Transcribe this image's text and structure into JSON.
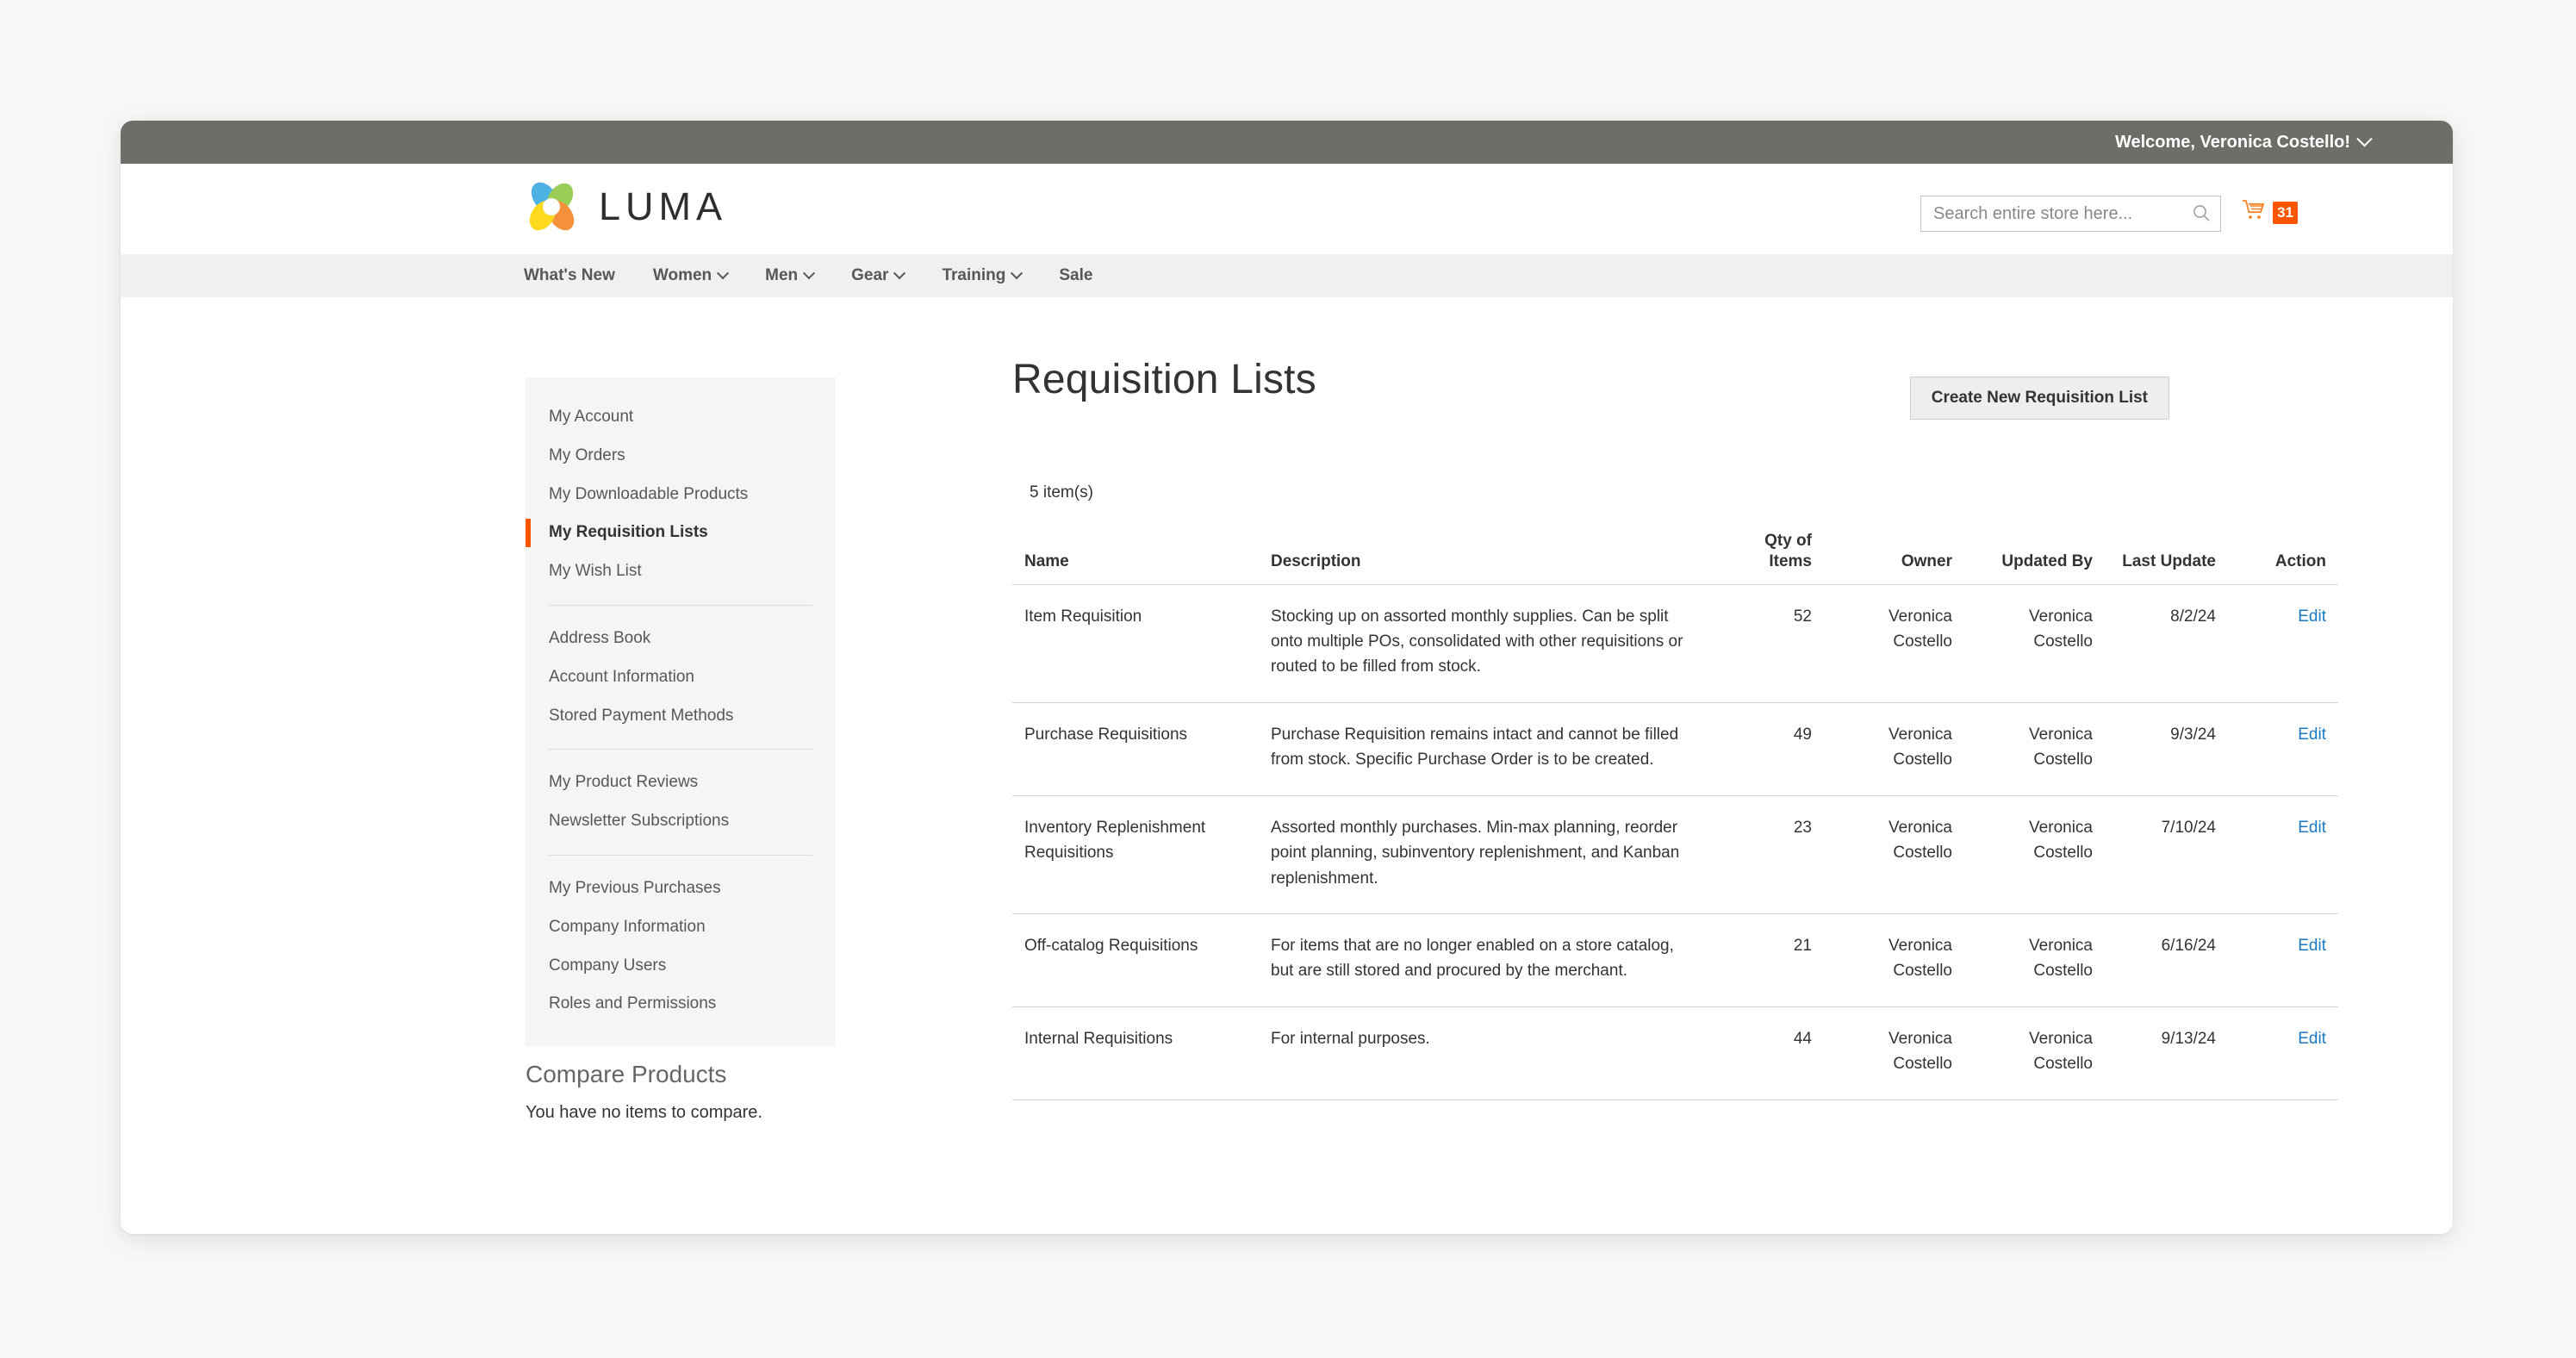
{
  "topbar": {
    "welcome": "Welcome, Veronica Costello!"
  },
  "brand": {
    "name": "LUMA"
  },
  "search": {
    "placeholder": "Search entire store here...",
    "value": ""
  },
  "cart": {
    "count": "31"
  },
  "nav": {
    "items": [
      {
        "label": "What's New",
        "has_caret": false
      },
      {
        "label": "Women",
        "has_caret": true
      },
      {
        "label": "Men",
        "has_caret": true
      },
      {
        "label": "Gear",
        "has_caret": true
      },
      {
        "label": "Training",
        "has_caret": true
      },
      {
        "label": "Sale",
        "has_caret": false
      }
    ]
  },
  "sidebar": {
    "groups": [
      {
        "items": [
          {
            "label": "My Account",
            "active": false
          },
          {
            "label": "My Orders",
            "active": false
          },
          {
            "label": "My Downloadable Products",
            "active": false
          },
          {
            "label": "My Requisition Lists",
            "active": true
          },
          {
            "label": "My Wish List",
            "active": false
          }
        ]
      },
      {
        "items": [
          {
            "label": "Address Book",
            "active": false
          },
          {
            "label": "Account Information",
            "active": false
          },
          {
            "label": "Stored Payment Methods",
            "active": false
          }
        ]
      },
      {
        "items": [
          {
            "label": "My Product Reviews",
            "active": false
          },
          {
            "label": "Newsletter Subscriptions",
            "active": false
          }
        ]
      },
      {
        "items": [
          {
            "label": "My Previous Purchases",
            "active": false
          },
          {
            "label": "Company Information",
            "active": false
          },
          {
            "label": "Company Users",
            "active": false
          },
          {
            "label": "Roles and Permissions",
            "active": false
          }
        ]
      }
    ]
  },
  "compare": {
    "title": "Compare Products",
    "empty_text": "You have no items to compare."
  },
  "main": {
    "title": "Requisition Lists",
    "create_button": "Create New Requisition List",
    "items_count": "5 item(s)",
    "table": {
      "headers": {
        "name": "Name",
        "description": "Description",
        "qty": "Qty of Items",
        "owner": "Owner",
        "updated_by": "Updated By",
        "last_update": "Last Update",
        "action": "Action"
      },
      "rows": [
        {
          "name": "Item Requisition",
          "description": "Stocking up on assorted monthly supplies. Can be split onto multiple POs, consolidated with other requisitions or routed to be filled from stock.",
          "qty": "52",
          "owner": "Veronica Costello",
          "updated_by": "Veronica Costello",
          "last_update": "8/2/24",
          "action": "Edit"
        },
        {
          "name": "Purchase Requisitions",
          "description": "Purchase Requisition remains intact and cannot be filled from stock. Specific Purchase Order is to be created.",
          "qty": "49",
          "owner": "Veronica Costello",
          "updated_by": "Veronica Costello",
          "last_update": "9/3/24",
          "action": "Edit"
        },
        {
          "name": "Inventory Replenishment Requisitions",
          "description": "Assorted monthly purchases. Min-max planning, reorder point planning, subinventory replenishment, and Kanban replenishment.",
          "qty": "23",
          "owner": "Veronica Costello",
          "updated_by": "Veronica Costello",
          "last_update": "7/10/24",
          "action": "Edit"
        },
        {
          "name": "Off-catalog Requisitions",
          "description": "For items that are no longer enabled on a store catalog, but are still stored and procured by the merchant.",
          "qty": "21",
          "owner": "Veronica Costello",
          "updated_by": "Veronica Costello",
          "last_update": "6/16/24",
          "action": "Edit"
        },
        {
          "name": "Internal Requisitions",
          "description": "For internal purposes.",
          "qty": "44",
          "owner": "Veronica Costello",
          "updated_by": "Veronica Costello",
          "last_update": "9/13/24",
          "action": "Edit"
        }
      ]
    }
  },
  "colors": {
    "accent_orange": "#ff5501",
    "link_blue": "#1979c3",
    "topbar_gray": "#6e6e69",
    "nav_gray": "#f0f0f0",
    "sidebar_gray": "#f5f5f5"
  },
  "icons": {
    "search": "search-icon",
    "cart": "cart-icon",
    "caret": "chevron-down-icon"
  }
}
